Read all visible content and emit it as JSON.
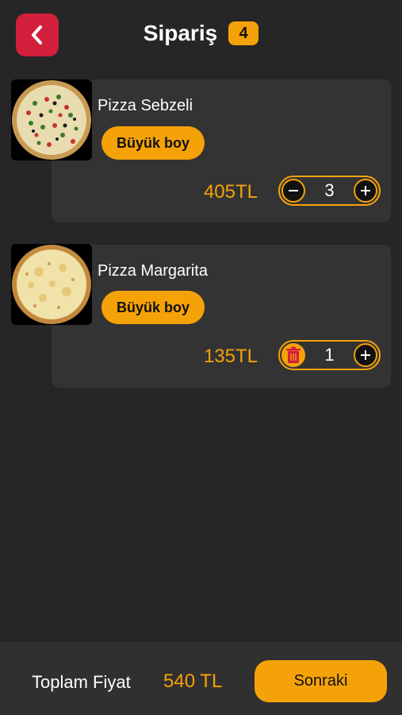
{
  "header": {
    "title": "Sipariş",
    "count": "4",
    "back_icon": "chevron-left-icon"
  },
  "items": [
    {
      "name": "Pizza Sebzeli",
      "size": "Büyük boy",
      "price": "405TL",
      "quantity": "3",
      "decrement_icon": "minus-icon",
      "increment_icon": "plus-icon"
    },
    {
      "name": "Pizza Margarita",
      "size": "Büyük boy",
      "price": "135TL",
      "quantity": "1",
      "decrement_icon": "trash-icon",
      "increment_icon": "plus-icon"
    }
  ],
  "footer": {
    "total_label": "Toplam Fiyat",
    "total_value": "540 TL",
    "next_label": "Sonraki"
  },
  "colors": {
    "background": "#262626",
    "card": "#333333",
    "accent": "#f5a208",
    "back_button": "#d21f3c",
    "trash": "#d21f3c"
  }
}
